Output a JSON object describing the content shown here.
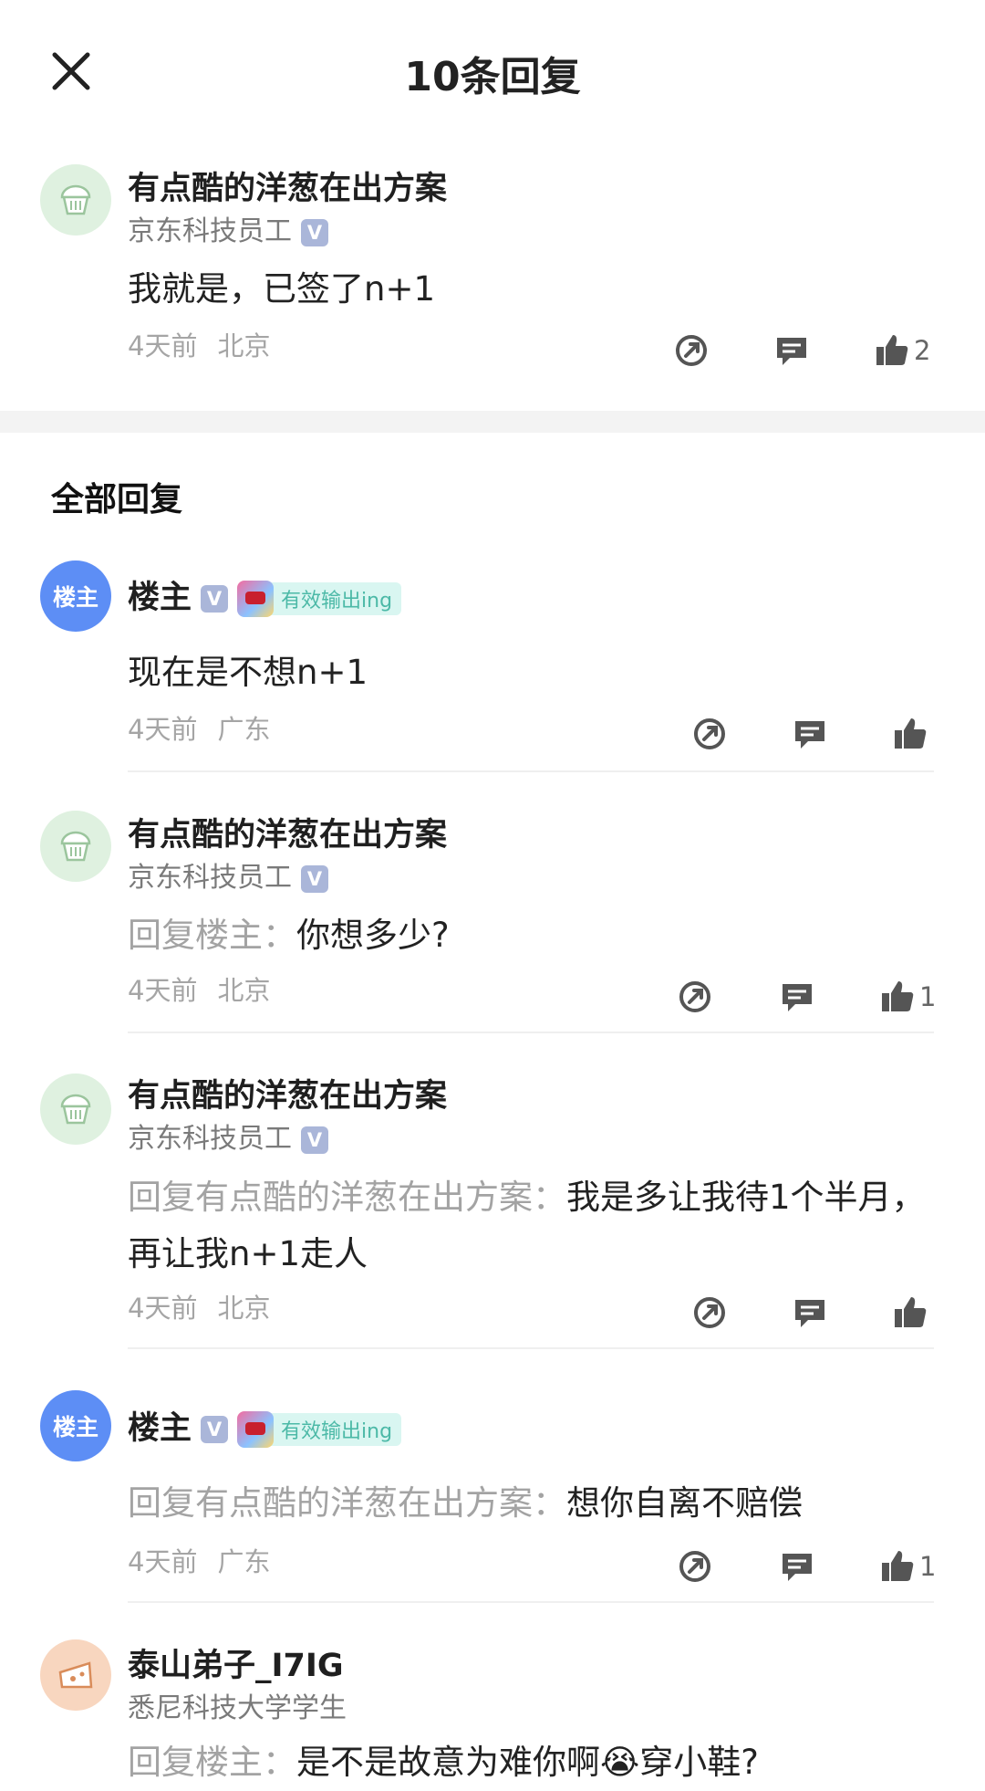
{
  "header": {
    "title": "10条回复",
    "close_icon": "close-icon"
  },
  "main_comment": {
    "name": "有点酷的洋葱在出方案",
    "subtitle": "京东科技员工",
    "verified": "V",
    "content": "我就是，已签了n+1",
    "time": "4天前",
    "location": "北京",
    "like_count": "2"
  },
  "section_title": "全部回复",
  "replies": [
    {
      "name": "楼主",
      "verified": "V",
      "tag": "有效输出ing",
      "avatar_text": "楼主",
      "content": "现在是不想n+1",
      "time": "4天前",
      "location": "广东",
      "like_count": ""
    },
    {
      "name": "有点酷的洋葱在出方案",
      "subtitle": "京东科技员工",
      "verified": "V",
      "prefix": "回复楼主：",
      "content": "你想多少?",
      "time": "4天前",
      "location": "北京",
      "like_count": "1"
    },
    {
      "name": "有点酷的洋葱在出方案",
      "subtitle": "京东科技员工",
      "verified": "V",
      "prefix": "回复有点酷的洋葱在出方案：",
      "content": "我是多让我待1个半月，再让我n+1走人",
      "time": "4天前",
      "location": "北京",
      "like_count": ""
    },
    {
      "name": "楼主",
      "verified": "V",
      "tag": "有效输出ing",
      "avatar_text": "楼主",
      "prefix": "回复有点酷的洋葱在出方案：",
      "content": "想你自离不赔偿",
      "time": "4天前",
      "location": "广东",
      "like_count": "1"
    },
    {
      "name": "泰山弟子_I7IG",
      "subtitle": "悉尼科技大学学生",
      "prefix": "回复楼主：",
      "content": "是不是故意为难你啊😭穿小鞋?"
    }
  ],
  "icons": {
    "share": "share-icon",
    "comment": "comment-icon",
    "like": "thumbs-up-icon"
  },
  "colors": {
    "accent_blue": "#5d8ef5",
    "tag_bg": "#d9f6f1",
    "tag_text": "#4cb9a7"
  }
}
